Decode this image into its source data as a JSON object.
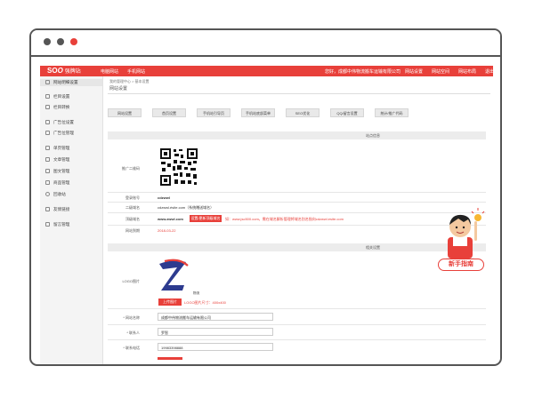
{
  "colors": {
    "accent": "#e8403a",
    "dot_dark": "#555555",
    "dot_red": "#e8403a"
  },
  "topbar": {
    "logo_main": "SO",
    "logo_o": "O",
    "logo_sub": "强牌站",
    "left_links": [
      "电脑网站",
      "手机网站"
    ],
    "greeting": "您好，成都中伟物流搬车运输有限公司",
    "right_links": [
      "网站设置",
      "网站空间",
      "网站布局",
      "退出"
    ]
  },
  "sidebar": {
    "items": [
      {
        "icon": "settings-icon",
        "label": "网站明细设置"
      },
      {
        "icon": "share-icon",
        "label": "栏目设置"
      },
      {
        "icon": "refresh-icon",
        "label": "栏目转换"
      },
      {
        "icon": "doc-icon",
        "label": "广告位设置"
      },
      {
        "icon": "doc-icon",
        "label": "广告位管理"
      },
      {
        "icon": "doc-icon",
        "label": "单页管理"
      },
      {
        "icon": "doc-icon",
        "label": "文章管理"
      },
      {
        "icon": "image-icon",
        "label": "图文管理"
      },
      {
        "icon": "grid-icon",
        "label": "商品管理"
      },
      {
        "icon": "clock-icon",
        "label": "回收站"
      },
      {
        "icon": "link-icon",
        "label": "友情链接"
      },
      {
        "icon": "doc-icon",
        "label": "留言管理"
      }
    ]
  },
  "main": {
    "breadcrumb": "我的管理中心 > 基本设置",
    "title": "网站设置",
    "tabs": [
      "网站设置",
      "首页设置",
      "手机站引导页",
      "手机站底部菜单",
      "SEO优化",
      "QQ/留言设置",
      "统计/推广代码"
    ],
    "section1_title": "站点信息",
    "rows": [
      {
        "label": "推广二维码",
        "value": ""
      },
      {
        "label": "登录账号",
        "value": "cdzwwl"
      },
      {
        "label": "二级域名",
        "value": "cdzwwl.ésite.com（系统赠送域名）"
      },
      {
        "label": "顶级域名",
        "value": "www.zwwl.com"
      },
      {
        "label": "网站到期",
        "value": "2018-03-22"
      }
    ],
    "bind_domain_button": "设置/更新顶级域名",
    "domain_hint": "如：www.jsc500.com，需在域名解析管理将域名别名指向cdzwwl.esite.com",
    "section2_title": "相关设置",
    "logo_label": "LOGO图片",
    "logo_caption": "物流",
    "upload_button": "上传图片",
    "logo_size_hint": "LOGO图片尺寸：400x400",
    "fields": [
      {
        "label": "* 网站名称",
        "value": "成都中伟物流搬车运输有限公司"
      },
      {
        "label": "* 联系人",
        "value": "罗智"
      },
      {
        "label": "* 联系电话",
        "value": "19983398888"
      }
    ]
  },
  "mascot": {
    "button_label": "新手指南"
  }
}
